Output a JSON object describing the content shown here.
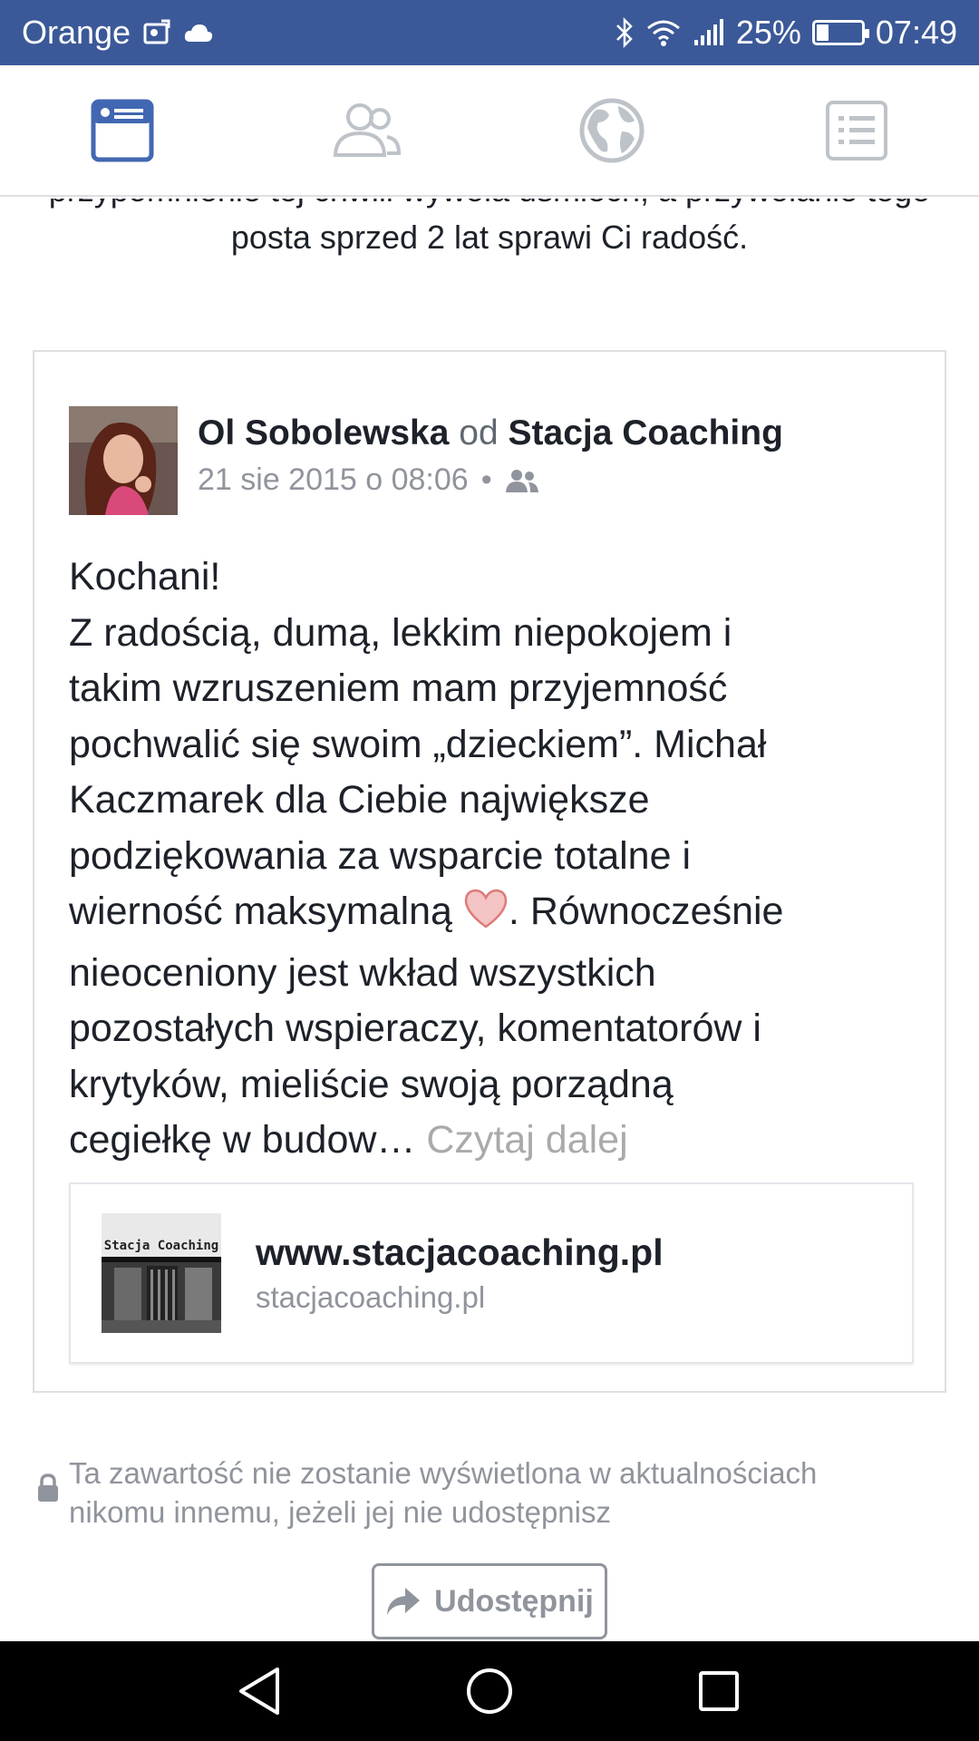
{
  "status_bar": {
    "carrier": "Orange",
    "battery_percent": "25%",
    "battery_level": 0.25,
    "time": "07:49"
  },
  "tabs": [
    {
      "name": "news-feed",
      "icon": "news-feed-icon",
      "active": true
    },
    {
      "name": "friends",
      "icon": "friends-icon",
      "active": false
    },
    {
      "name": "notifications",
      "icon": "globe-icon",
      "active": false
    },
    {
      "name": "menu",
      "icon": "menu-icon",
      "active": false
    }
  ],
  "intro": {
    "cut_line": "przypomnienie tej chwili wywoła uśmiech, a przywołanie tego",
    "line": "posta sprzed 2 lat sprawi Ci radość."
  },
  "post": {
    "author": "Ol Sobolewska",
    "connector": "od",
    "page": "Stacja Coaching",
    "timestamp": "21 sie 2015 o 08:06",
    "separator": "•",
    "audience_icon": "friends-audience-icon",
    "body_lines": [
      "Kochani!",
      "Z radością, dumą, lekkim niepokojem i",
      "takim wzruszeniem mam przyjemność",
      "pochwalić się swoim „dzieckiem”. Michał",
      "Kaczmarek dla Ciebie największe",
      "podziękowania za wsparcie totalne i"
    ],
    "body_heart_before": "wierność maksymalną ",
    "body_heart_after": ". Równocześnie",
    "body_lines_2": [
      "nieoceniony jest wkład wszystkich",
      "pozostałych wspieraczy, komentatorów i",
      "krytyków, mieliście swoją porządną"
    ],
    "body_last": "cegiełkę w budow… ",
    "read_more": "Czytaj dalej"
  },
  "link_preview": {
    "thumb_text": "Stacja Coaching",
    "title": "www.stacjacoaching.pl",
    "domain": "stacjacoaching.pl"
  },
  "privacy_note": {
    "line1": "Ta zawartość nie zostanie wyświetlona w aktualnościach",
    "line2": "nikomu innemu, jeżeli jej nie udostępnisz"
  },
  "share_button": {
    "label": "Udostępnij"
  },
  "colors": {
    "status_bar": "#3b5998",
    "active_tab": "#4267b2",
    "inactive_tab": "#bec3c9",
    "muted_text": "#90949c"
  }
}
